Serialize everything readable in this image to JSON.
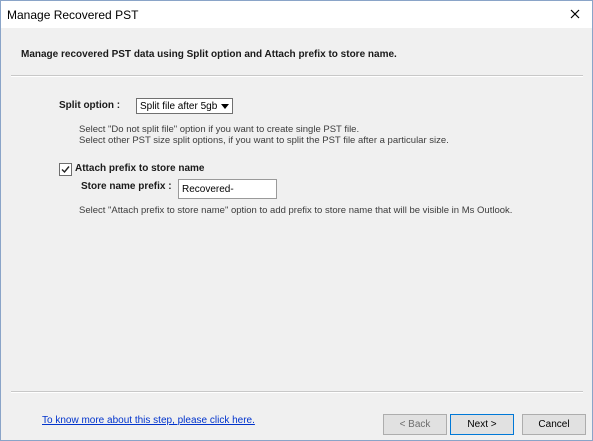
{
  "window": {
    "title": "Manage Recovered PST"
  },
  "header": {
    "text": "Manage recovered PST data using Split option and Attach prefix to store name."
  },
  "split": {
    "label": "Split option :",
    "selected": "Split file after 5gb",
    "hint1": "Select \"Do not split file\" option if you want to create single PST file.",
    "hint2": "Select other PST size split options, if you want to split the PST file after a particular size."
  },
  "attach": {
    "checked": true,
    "label": "Attach prefix to store name",
    "store_label": "Store name prefix :",
    "store_value": "Recovered-",
    "hint": "Select \"Attach prefix to store name\" option to add prefix to store name that will be visible in Ms Outlook."
  },
  "footer": {
    "help_link": "To know more about this step, please click here.",
    "back_label": "< Back",
    "next_label": "Next >",
    "cancel_label": "Cancel"
  }
}
